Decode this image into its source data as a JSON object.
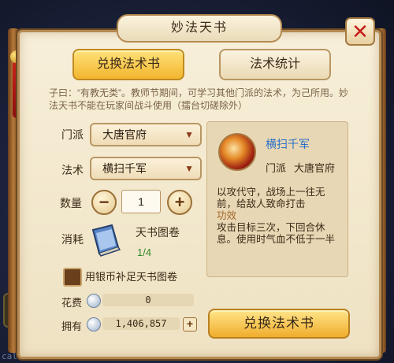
{
  "window": {
    "title": "妙法天书"
  },
  "tabs": [
    {
      "label": "兑换法术书",
      "active": true
    },
    {
      "label": "法术统计",
      "active": false
    }
  ],
  "description": "子曰：“有教无类”。教师节期间，可学习其他门派的法术，为己所用。妙法天书不能在玩家间战斗使用（擂台切磋除外）",
  "form": {
    "sect_label": "门派",
    "sect_value": "大唐官府",
    "skill_label": "法术",
    "skill_value": "横扫千军",
    "qty_label": "数量",
    "qty_value": "1",
    "consume_label": "消耗",
    "consume_item": "天书图卷",
    "consume_count": "1/4",
    "checkbox_label": "用银币补足天书图卷",
    "cost_label": "花费",
    "cost_value": "0",
    "own_label": "拥有",
    "own_value": "1,406,857"
  },
  "skill_card": {
    "name": "横扫千军",
    "sect_label": "门派",
    "sect_value": "大唐官府",
    "desc_line1": "以攻代守，战场上一往无前，给敌人致命打击",
    "desc_head": "功效",
    "desc_line2": "攻击目标三次，下回合休息。使用时气血不低于一半"
  },
  "exchange_button": "兑换法术书",
  "background_text": "caller=/sys/common/rp",
  "colors": {
    "accent_gold": "#f2b62e",
    "skill_name_blue": "#2a70c8",
    "count_green": "#2f8a2a",
    "close_red": "#c81e1e"
  }
}
